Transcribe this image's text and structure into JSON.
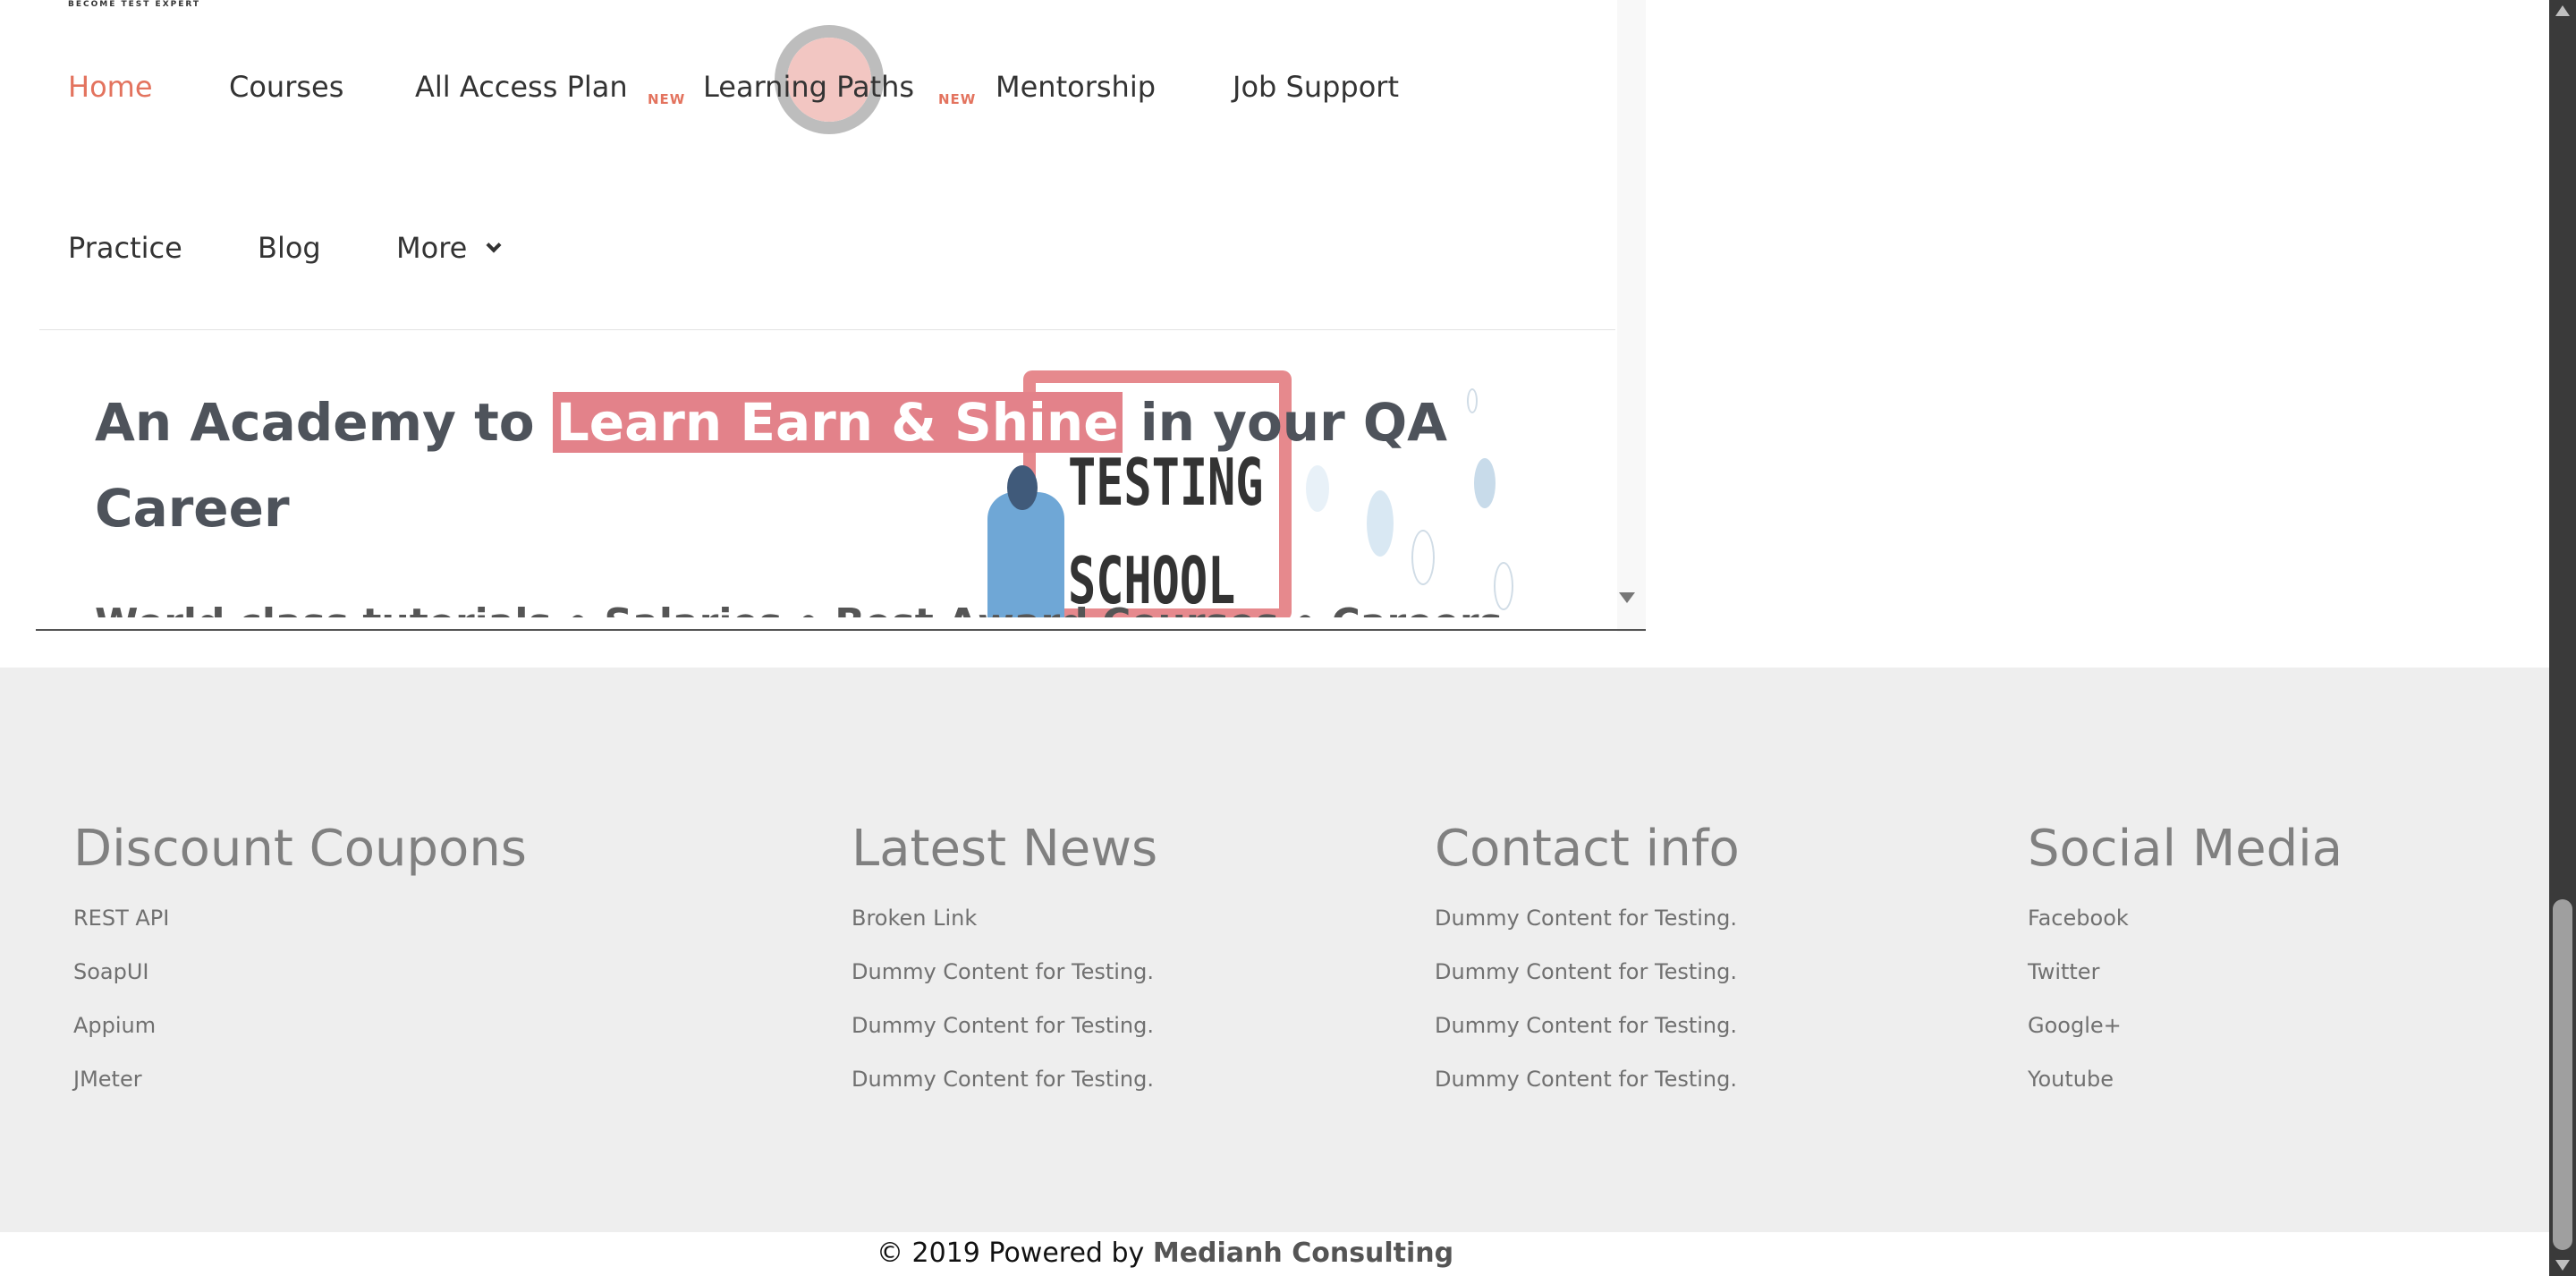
{
  "header": {
    "tagline": "BECOME TEST EXPERT",
    "nav": {
      "home": "Home",
      "courses": "Courses",
      "all_access_plan": "All Access Plan",
      "all_access_badge": "NEW",
      "learning_paths": "Learning Paths",
      "learning_paths_badge": "NEW",
      "mentorship": "Mentorship",
      "job_support": "Job Support",
      "practice": "Practice",
      "blog": "Blog",
      "more": "More"
    }
  },
  "hero": {
    "title_before": "An Academy to",
    "title_highlight": "Learn Earn & Shine",
    "title_after": "in your QA Career",
    "subtitle_partial": "World class tutorials • Salaries • Best Award Courses • Careers",
    "illustration_text_line1": "TESTING",
    "illustration_text_line2": "SCHOOL"
  },
  "footer": {
    "discount_coupons": {
      "heading": "Discount Coupons",
      "links": [
        "REST API",
        "SoapUI",
        "Appium",
        "JMeter"
      ]
    },
    "latest_news": {
      "heading": "Latest News",
      "links": [
        "Broken Link",
        "Dummy Content for Testing.",
        "Dummy Content for Testing.",
        "Dummy Content for Testing."
      ]
    },
    "contact_info": {
      "heading": "Contact info",
      "links": [
        "Dummy Content for Testing.",
        "Dummy Content for Testing.",
        "Dummy Content for Testing.",
        "Dummy Content for Testing."
      ]
    },
    "social_media": {
      "heading": "Social Media",
      "links": [
        "Facebook",
        "Twitter",
        "Google+",
        "Youtube"
      ]
    }
  },
  "copyright": {
    "text": "© 2019 Powered by",
    "brand": "Medianh Consulting"
  },
  "colors": {
    "accent": "#e3735e",
    "highlight": "#e3828a",
    "footer_bg": "#eeeeee"
  }
}
